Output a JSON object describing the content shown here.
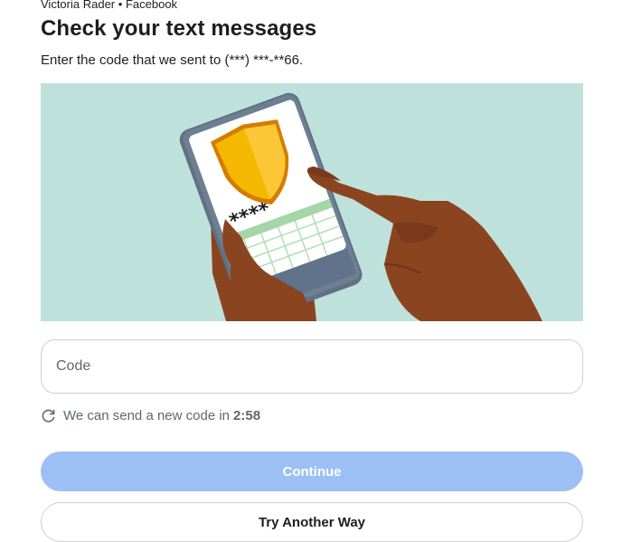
{
  "header": {
    "account_name": "Victoria Rader",
    "separator": "•",
    "platform": "Facebook",
    "title": "Check your text messages",
    "subtitle": "Enter the code that we sent to (***) ***-**66."
  },
  "illustration": {
    "icon": "phone-with-shield-illustration",
    "masked_code": "****",
    "background_color": "#bfe1dc",
    "shield_color": "#f5b800"
  },
  "form": {
    "code_placeholder": "Code",
    "code_value": ""
  },
  "resend": {
    "icon": "refresh-icon",
    "text": "We can send a new code in",
    "timer": "2:58"
  },
  "buttons": {
    "continue_label": "Continue",
    "try_another_label": "Try Another Way"
  },
  "colors": {
    "primary_disabled": "#9cc0f3",
    "text_primary": "#1c1e21",
    "text_secondary": "#606770",
    "border": "#ccd0d5"
  }
}
